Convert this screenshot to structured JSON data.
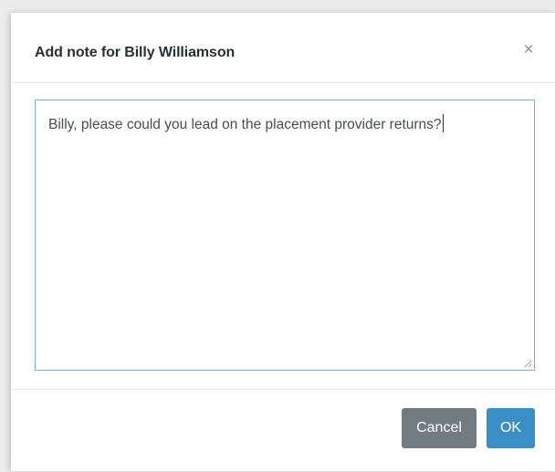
{
  "dialog": {
    "title": "Add note for Billy Williamson",
    "close_symbol": "×",
    "close_icon": "close-icon"
  },
  "note": {
    "value": "Billy, please could you lead on the placement provider returns?"
  },
  "footer": {
    "cancel_label": "Cancel",
    "ok_label": "OK"
  },
  "colors": {
    "ok_button": "#3a8fc7",
    "cancel_button": "#727a82",
    "textarea_border": "#7fb0d9"
  }
}
